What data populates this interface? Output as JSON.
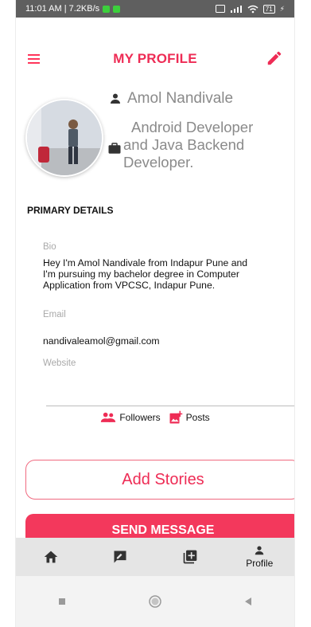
{
  "status_bar": {
    "time_speed": "11:01 AM | 7.2KB/s",
    "battery": "71"
  },
  "header": {
    "title": "MY PROFILE"
  },
  "profile": {
    "name": "Amol Nandivale",
    "title_lines": [
      "Android Developer",
      "and Java Backend",
      "Developer."
    ]
  },
  "primary_details": {
    "section_title": "PRIMARY DETAILS",
    "bio_label": "Bio",
    "bio_lines": [
      "Hey I'm Amol Nandivale from Indapur Pune and",
      "I'm pursuing my bachelor degree in Computer",
      "Application from VPCSC, Indapur Pune."
    ],
    "email_label": "Email",
    "email_value": "nandivaleamol@gmail.com",
    "website_label": "Website",
    "website_value": ""
  },
  "stats": {
    "followers_label": "Followers",
    "posts_label": "Posts"
  },
  "buttons": {
    "add_stories": "Add Stories",
    "send_message": "SEND MESSAGE"
  },
  "bottom_nav": {
    "profile_label": "Profile"
  },
  "colors": {
    "accent": "#ee2c55",
    "button_bg": "#f3385c",
    "nav_bg": "#e5e5e5",
    "status_bg": "#5f5f5f"
  }
}
